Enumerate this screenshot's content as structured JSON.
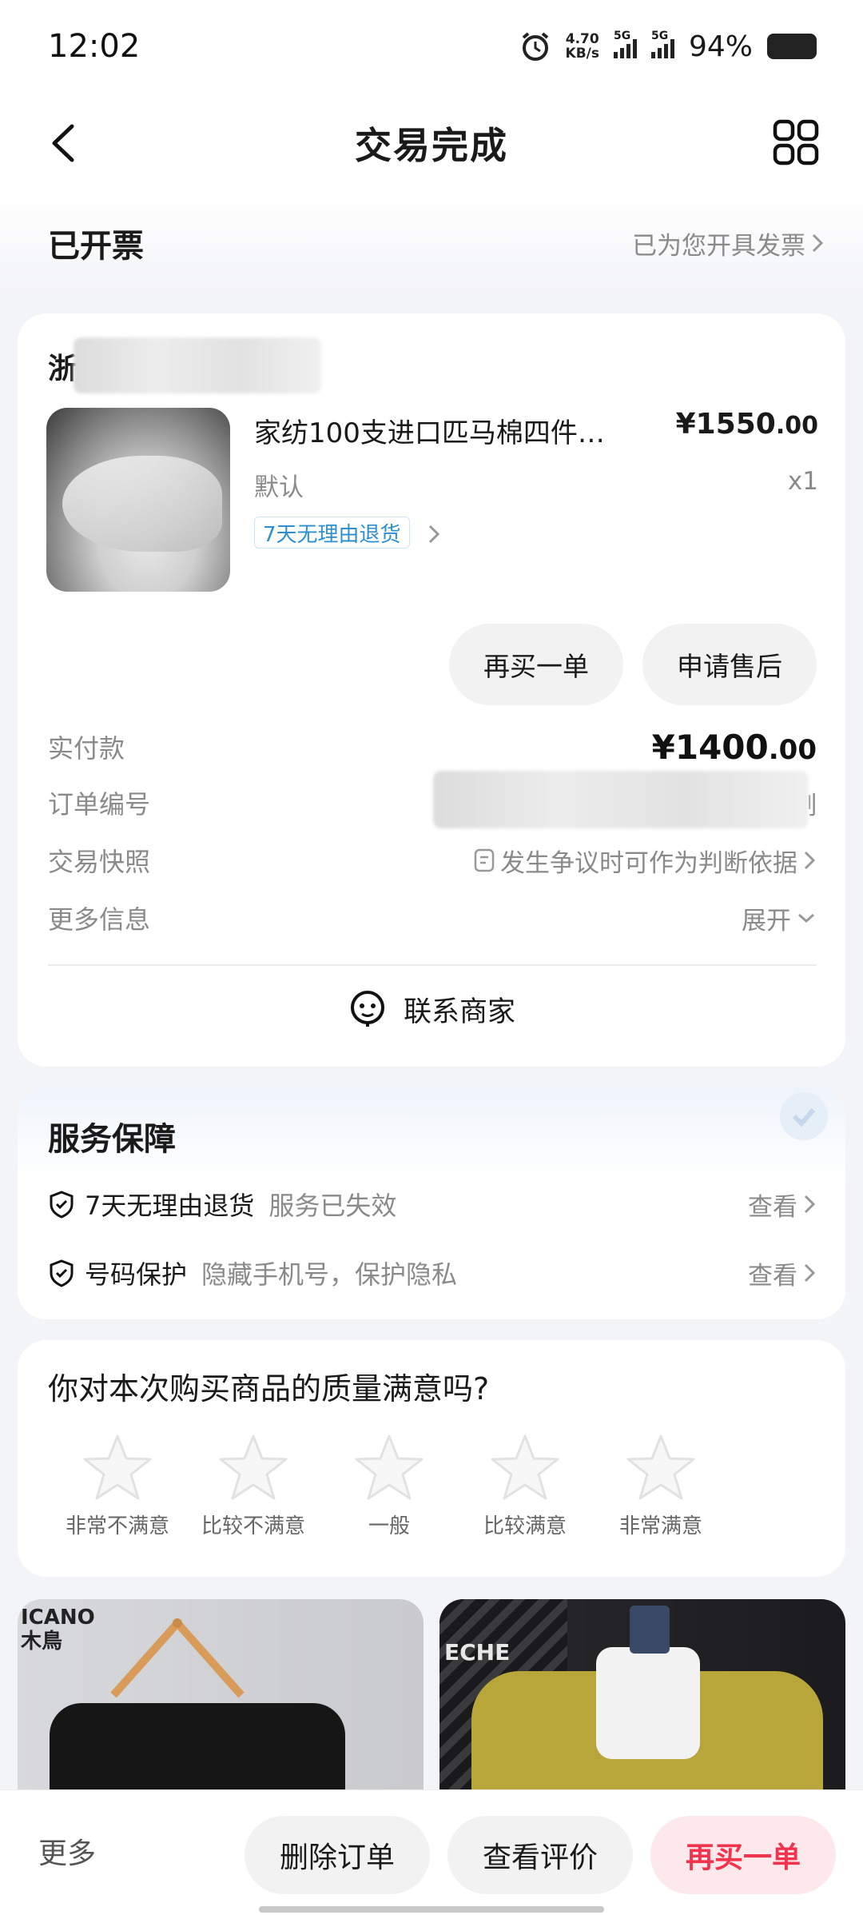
{
  "status_bar": {
    "time": "12:02",
    "net_speed": "4.70",
    "net_unit": "KB/s",
    "sim1": "5G",
    "sim2": "5G",
    "battery": "94%"
  },
  "header": {
    "title": "交易完成"
  },
  "invoice": {
    "status": "已开票",
    "link": "已为您开具发票"
  },
  "order": {
    "shop_name": "浙",
    "product": {
      "title": "家纺100支进口匹马棉四件…",
      "price_int": "¥1550",
      "price_dec": ".00",
      "spec": "默认",
      "qty": "x1",
      "tag": "7天无理由退货"
    },
    "buttons": {
      "rebuy": "再买一单",
      "aftersale": "申请售后"
    },
    "details": [
      {
        "label": "实付款",
        "value_int": "¥1400",
        "value_dec": ".00"
      },
      {
        "label": "订单编号",
        "value": "制"
      },
      {
        "label": "交易快照",
        "value": "发生争议时可作为判断依据"
      },
      {
        "label": "更多信息",
        "value": "展开"
      }
    ],
    "contact": "联系商家"
  },
  "service": {
    "title": "服务保障",
    "items": [
      {
        "name": "7天无理由退货",
        "desc": "服务已失效",
        "link": "查看"
      },
      {
        "name": "号码保护",
        "desc": "隐藏手机号，保护隐私",
        "link": "查看"
      }
    ]
  },
  "rating": {
    "question": "你对本次购买商品的质量满意吗?",
    "options": [
      "非常不满意",
      "比较不满意",
      "一般",
      "比较满意",
      "非常满意"
    ],
    "selected": 0
  },
  "recommend": {
    "left_brand": "ICANO",
    "left_brand_cn": "木鳥",
    "right_brand": "ECHE"
  },
  "bottom_bar": {
    "more": "更多",
    "delete": "删除订单",
    "review": "查看评价",
    "rebuy": "再买一单"
  },
  "colors": {
    "accent": "#f0344e",
    "tag_blue": "#2b8fd0"
  }
}
